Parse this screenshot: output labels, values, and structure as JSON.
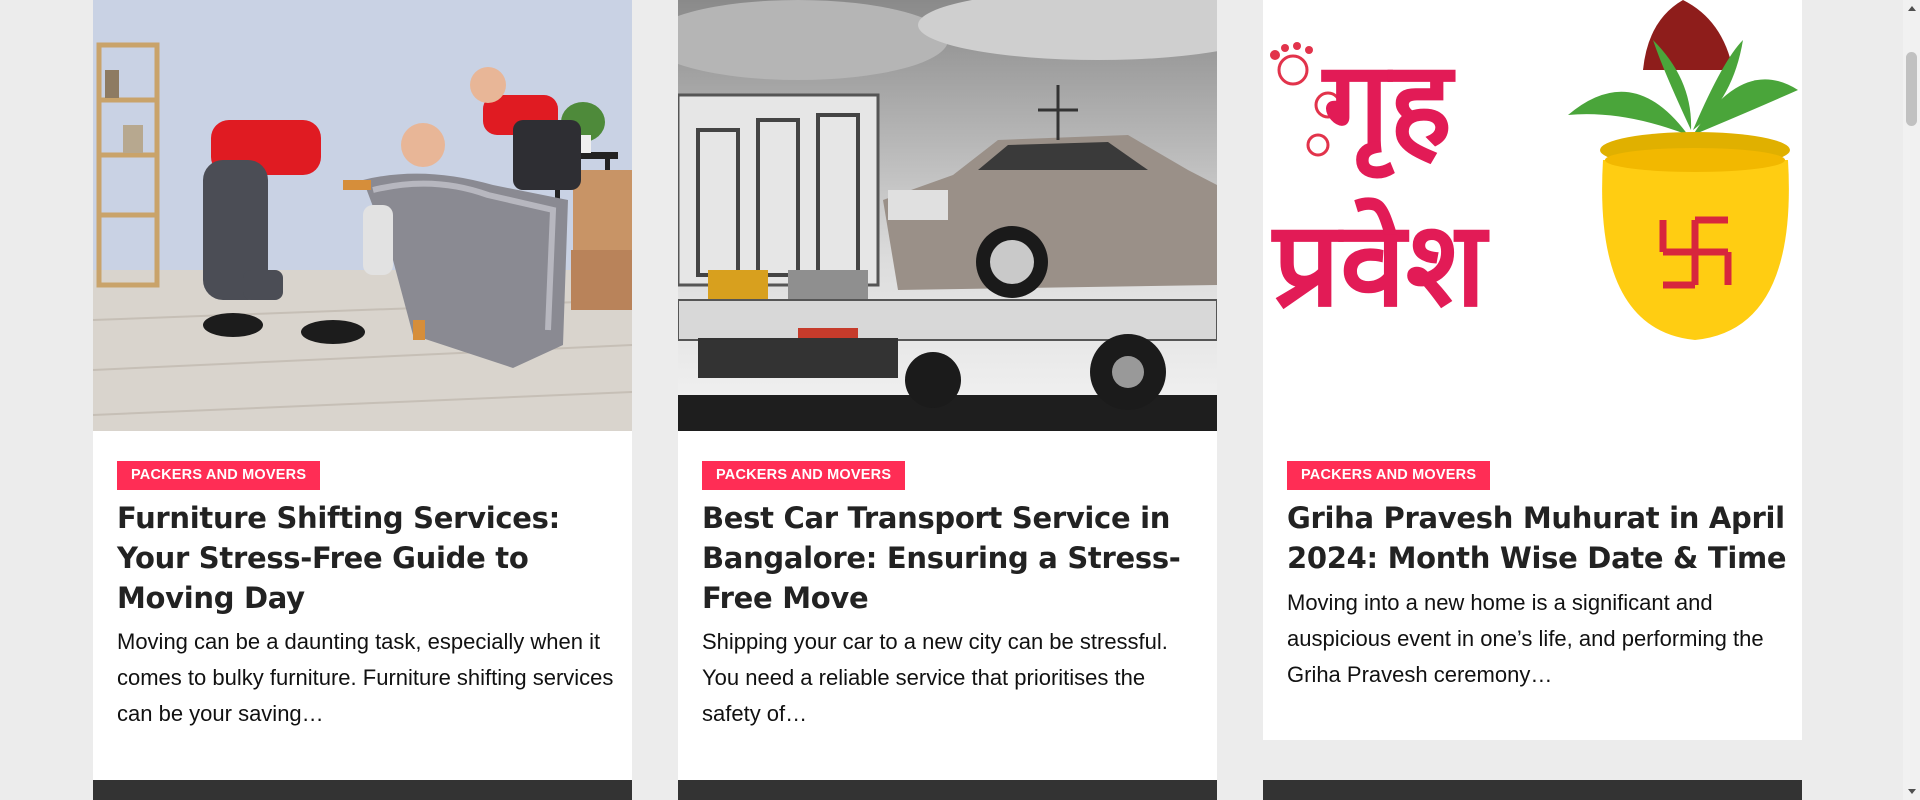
{
  "colors": {
    "accent": "#ff2d55",
    "card_bg": "#ffffff",
    "page_bg": "#ececec",
    "footer_bar": "#333333"
  },
  "cards": [
    {
      "category": "PACKERS AND MOVERS",
      "title": "Furniture Shifting Services: Your Stress-Free Guide to Moving Day",
      "excerpt": "Moving can be a daunting task, especially when it comes to bulky furniture. Furniture shifting services can be your saving…",
      "image": "movers-wrapping-chair"
    },
    {
      "category": "PACKERS AND MOVERS",
      "title": "Best Car Transport Service in Bangalore: Ensuring a Stress-Free Move",
      "excerpt": "Shipping your car to a new city can be stressful. You need a reliable service that prioritises the safety of…",
      "image": "car-on-tow-truck"
    },
    {
      "category": "PACKERS AND MOVERS",
      "title": "Griha Pravesh Muhurat in April 2024: Month Wise Date & Time",
      "excerpt": "Moving into a new home is a significant and auspicious event in one’s life, and performing the Griha Pravesh ceremony…",
      "image": "griha-pravesh-kalash",
      "image_text": "गृह प्रवेश"
    }
  ]
}
